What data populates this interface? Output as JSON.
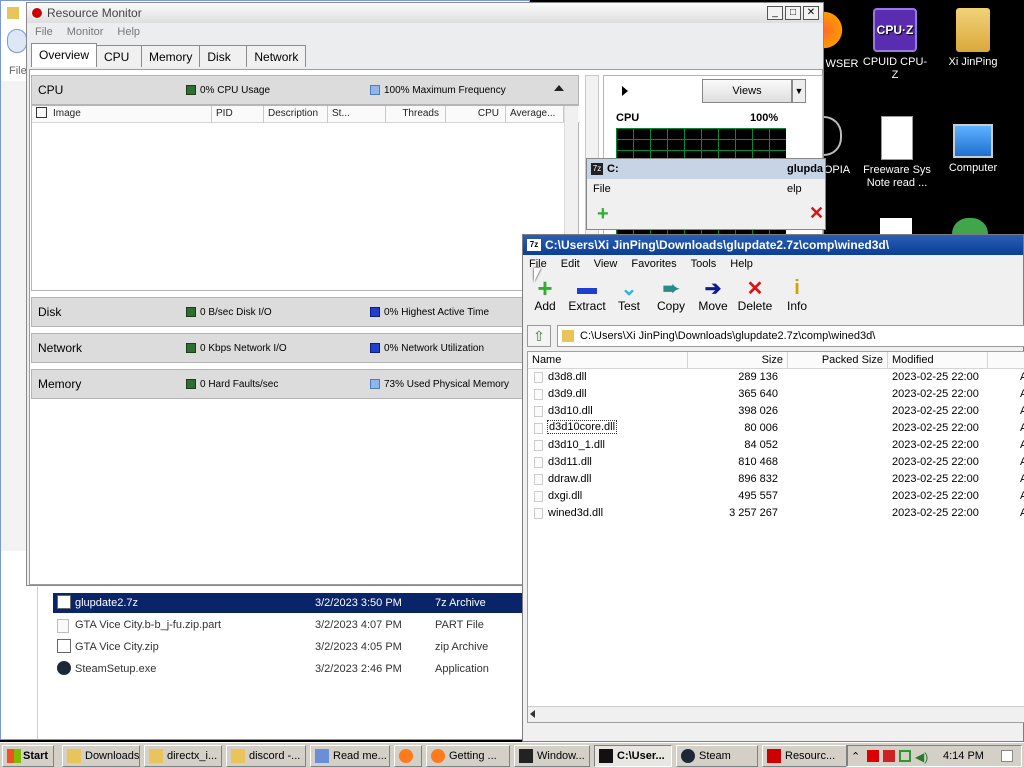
{
  "desktop": {
    "icons": [
      {
        "label": "WSER",
        "icon": "browser-icon"
      },
      {
        "label": "CPUID CPU-Z",
        "icon": "cpuz-icon"
      },
      {
        "label": "Xi JinPing",
        "icon": "user-folder-icon"
      },
      {
        "label": "OPIA",
        "icon": "app-icon"
      },
      {
        "label": "Freeware Sys Note read ...",
        "icon": "document-icon"
      },
      {
        "label": "Computer",
        "icon": "computer-icon"
      }
    ]
  },
  "explorer_behind": {
    "menu_file": "File",
    "files": [
      {
        "name": "glupdate2.7z",
        "date": "3/2/2023 3:50 PM",
        "type": "7z Archive",
        "selected": true
      },
      {
        "name": "GTA Vice City.b-b_j-fu.zip.part",
        "date": "3/2/2023 4:07 PM",
        "type": "PART File"
      },
      {
        "name": "GTA Vice City.zip",
        "date": "3/2/2023 4:05 PM",
        "type": "zip Archive"
      },
      {
        "name": "SteamSetup.exe",
        "date": "3/2/2023 2:46 PM",
        "type": "Application"
      }
    ]
  },
  "resmon": {
    "title": "Resource Monitor",
    "menu": [
      "File",
      "Monitor",
      "Help"
    ],
    "tabs": [
      "Overview",
      "CPU",
      "Memory",
      "Disk",
      "Network"
    ],
    "cpu": {
      "title": "CPU",
      "ind1": "0% CPU Usage",
      "ind2": "100% Maximum Frequency",
      "columns": [
        "Image",
        "PID",
        "Description",
        "St...",
        "Threads",
        "CPU",
        "Average..."
      ]
    },
    "disk": {
      "title": "Disk",
      "ind1": "0 B/sec Disk I/O",
      "ind2": "0% Highest Active Time"
    },
    "network": {
      "title": "Network",
      "ind1": "0 Kbps Network I/O",
      "ind2": "0% Network Utilization"
    },
    "memory": {
      "title": "Memory",
      "ind1": "0 Hard Faults/sec",
      "ind2": "73% Used Physical Memory"
    },
    "views_label": "Views",
    "graph_title": "CPU",
    "graph_value": "100%"
  },
  "sevz_back": {
    "title": "C:",
    "title_right": "glupda",
    "menu_file": "File",
    "menu_help": "elp"
  },
  "sevz": {
    "title": "C:\\Users\\Xi JinPing\\Downloads\\glupdate2.7z\\comp\\wined3d\\",
    "menu": [
      "File",
      "Edit",
      "View",
      "Favorites",
      "Tools",
      "Help"
    ],
    "toolbar": [
      "Add",
      "Extract",
      "Test",
      "Copy",
      "Move",
      "Delete",
      "Info"
    ],
    "address": "C:\\Users\\Xi JinPing\\Downloads\\glupdate2.7z\\comp\\wined3d\\",
    "columns": [
      "Name",
      "Size",
      "Packed Size",
      "Modified"
    ],
    "files": [
      {
        "name": "d3d8.dll",
        "size": "289 136",
        "modified": "2023-02-25 22:00"
      },
      {
        "name": "d3d9.dll",
        "size": "365 640",
        "modified": "2023-02-25 22:00"
      },
      {
        "name": "d3d10.dll",
        "size": "398 026",
        "modified": "2023-02-25 22:00"
      },
      {
        "name": "d3d10core.dll",
        "size": "80 006",
        "modified": "2023-02-25 22:00",
        "focused": true
      },
      {
        "name": "d3d10_1.dll",
        "size": "84 052",
        "modified": "2023-02-25 22:00"
      },
      {
        "name": "d3d11.dll",
        "size": "810 468",
        "modified": "2023-02-25 22:00"
      },
      {
        "name": "ddraw.dll",
        "size": "896 832",
        "modified": "2023-02-25 22:00"
      },
      {
        "name": "dxgi.dll",
        "size": "495 557",
        "modified": "2023-02-25 22:00"
      },
      {
        "name": "wined3d.dll",
        "size": "3 257 267",
        "modified": "2023-02-25 22:00"
      }
    ],
    "attr_col": "A"
  },
  "taskbar": {
    "start": "Start",
    "items": [
      {
        "label": "Downloads"
      },
      {
        "label": "directx_i..."
      },
      {
        "label": "discord -..."
      },
      {
        "label": "Read me..."
      },
      {
        "label": ""
      },
      {
        "label": "Getting ..."
      },
      {
        "label": "Window..."
      },
      {
        "label": "C:\\User...",
        "active": true
      },
      {
        "label": "Steam"
      },
      {
        "label": "Resourc..."
      }
    ],
    "clock": "4:14 PM"
  },
  "colors": {
    "accent": "#0a246a",
    "sevz_title": "#0b3f96",
    "graph_bg": "#000000",
    "graph_grid": "#008a3a"
  }
}
